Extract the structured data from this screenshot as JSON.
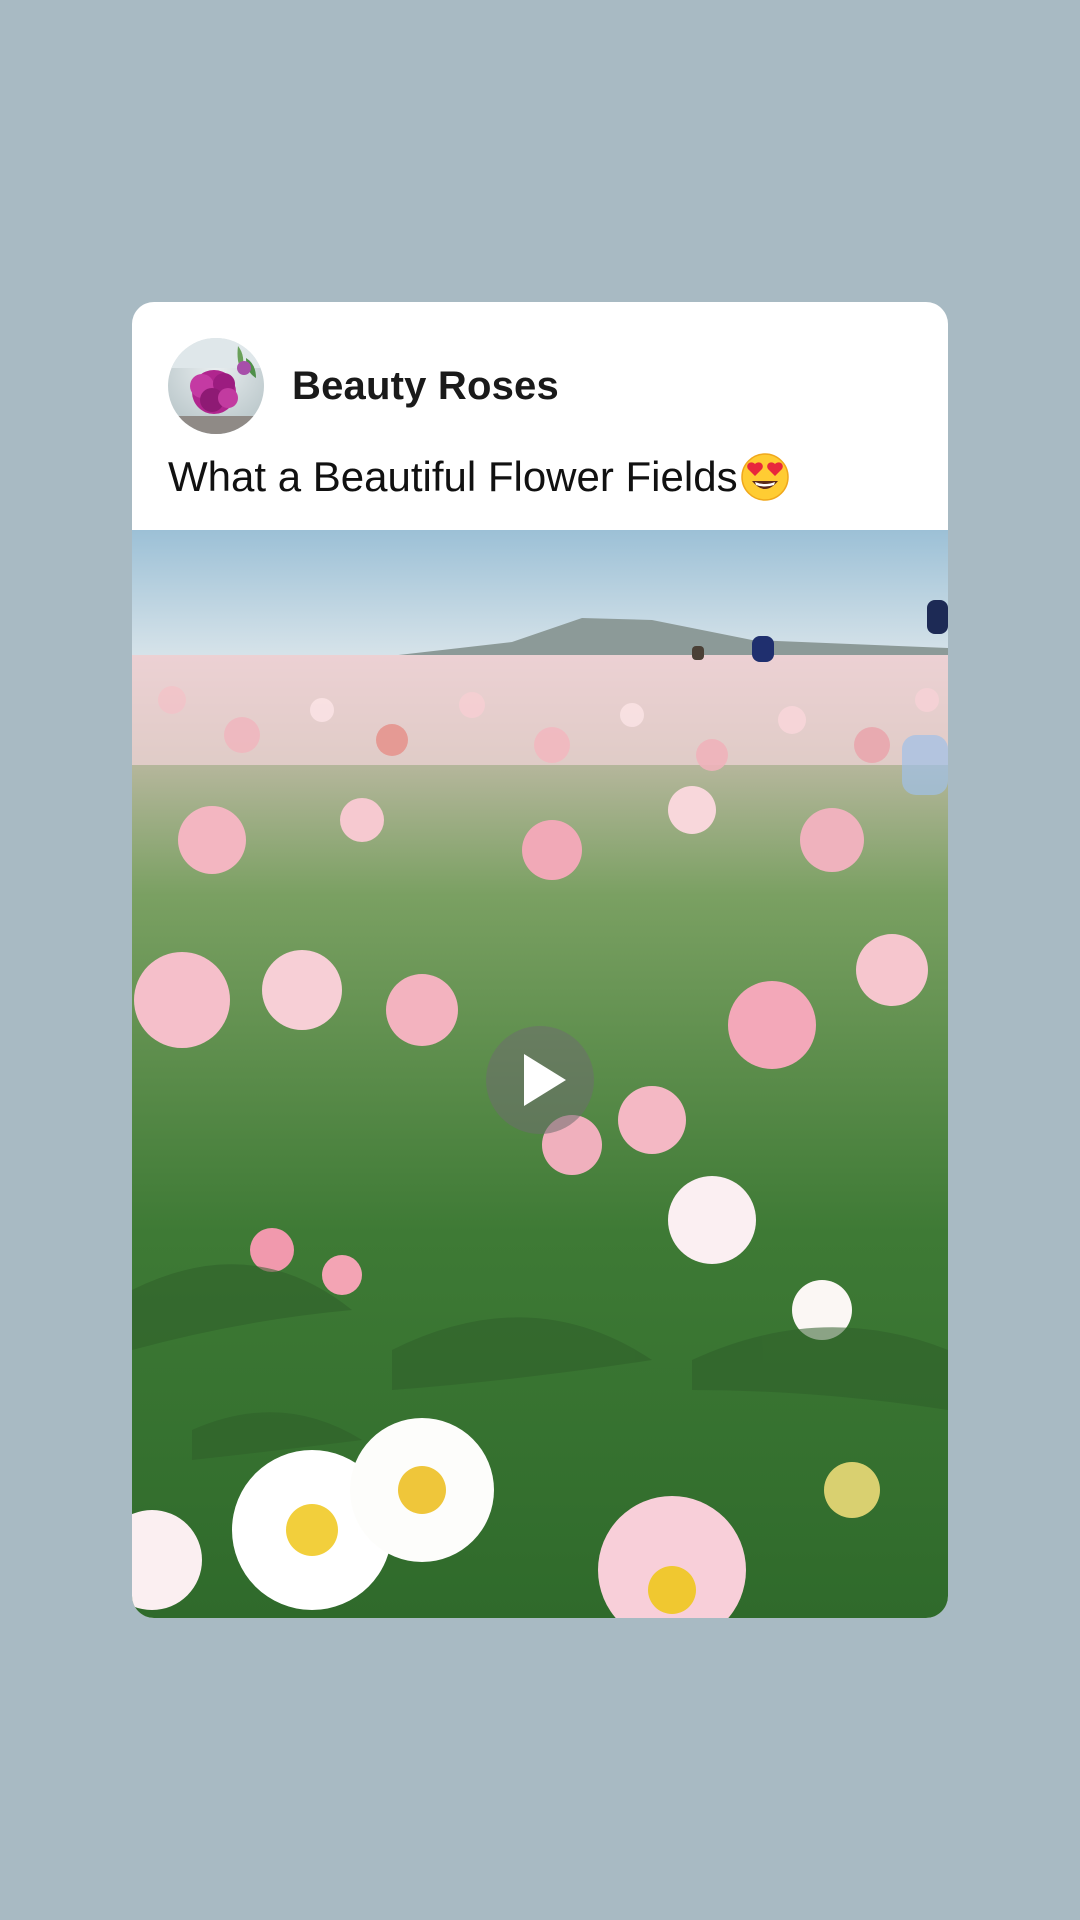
{
  "post": {
    "author": "Beauty Roses",
    "caption": "What a Beautiful Flower Fields",
    "caption_emoji": "smiling-face-with-heart-eyes"
  },
  "media": {
    "type": "video",
    "state": "paused",
    "play_icon": "play-icon"
  },
  "colors": {
    "background": "#a8bac3",
    "card": "#ffffff",
    "text": "#111111"
  }
}
